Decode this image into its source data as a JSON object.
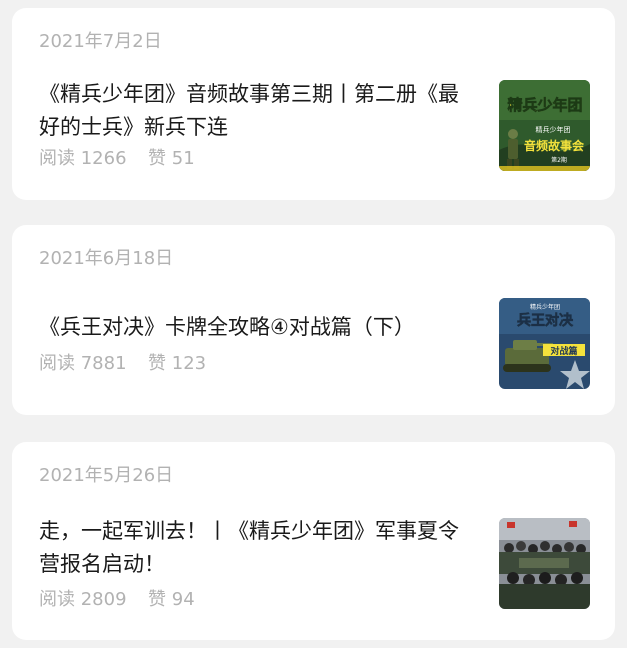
{
  "articles": [
    {
      "date": "2021年7月2日",
      "title": "《精兵少年团》音频故事第三期丨第二册《最好的士兵》新兵下连",
      "read_label": "阅读",
      "read_count": "1266",
      "like_label": "赞",
      "like_count": "51",
      "thumb": {
        "headline": "精兵少年团",
        "badge": "精兵少年团",
        "caption": "音频故事会",
        "volume": "第2期"
      }
    },
    {
      "date": "2021年6月18日",
      "title": "《兵王对决》卡牌全攻略④对战篇（下）",
      "read_label": "阅读",
      "read_count": "7881",
      "like_label": "赞",
      "like_count": "123",
      "thumb": {
        "badge": "精兵少年团",
        "headline": "兵王对决",
        "caption": "对战篇"
      }
    },
    {
      "date": "2021年5月26日",
      "title": "走，一起军训去！丨《精兵少年团》军事夏令营报名启动！",
      "read_label": "阅读",
      "read_count": "2809",
      "like_label": "赞",
      "like_count": "94"
    }
  ]
}
